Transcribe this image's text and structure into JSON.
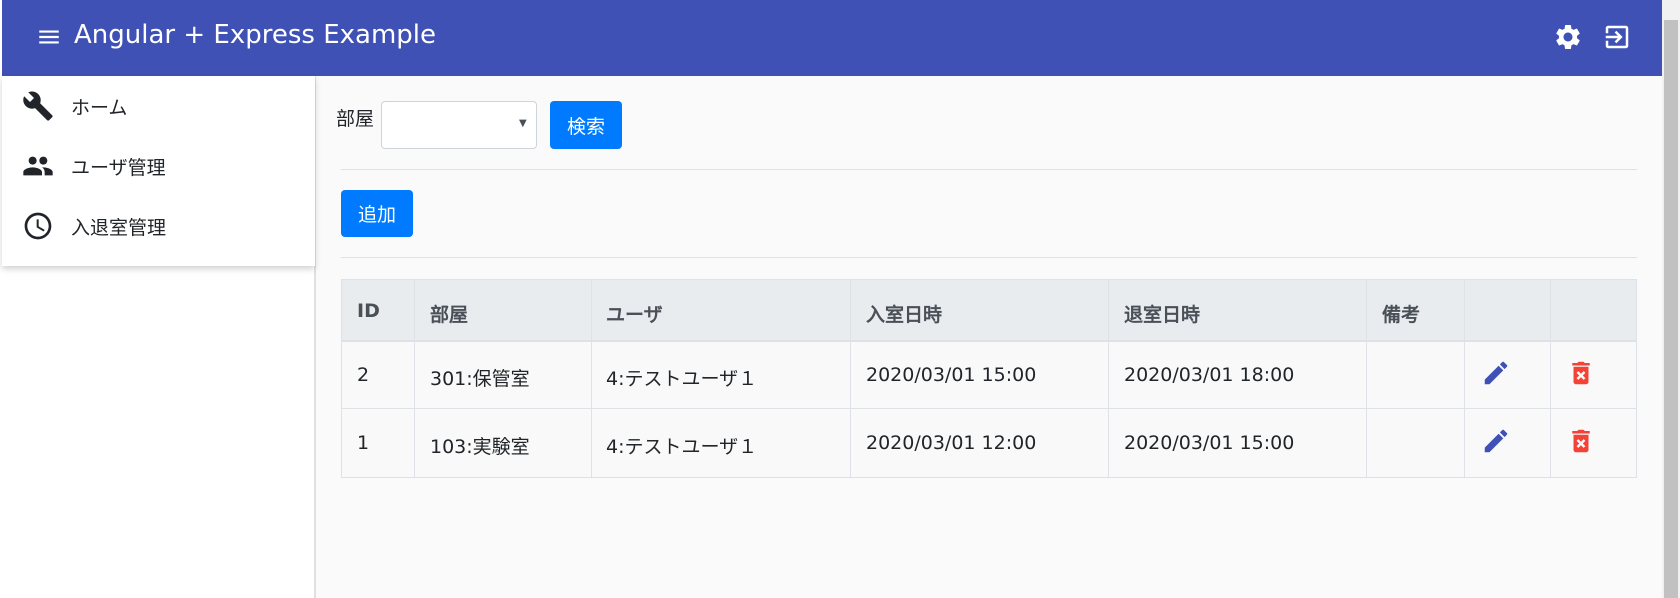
{
  "app": {
    "title": "Angular + Express Example",
    "accent_color": "#3f51b5",
    "primary_button_color": "#007bff",
    "icons": {
      "menu": "hamburger-menu-icon",
      "settings": "gear-icon",
      "logout": "exit-to-app-icon"
    }
  },
  "sidebar": {
    "items": [
      {
        "label": "ホーム",
        "icon": "wrench-icon"
      },
      {
        "label": "ユーザ管理",
        "icon": "people-icon"
      },
      {
        "label": "入退室管理",
        "icon": "clock-icon"
      }
    ]
  },
  "search": {
    "room_label": "部屋",
    "room_value": "",
    "search_button": "検索"
  },
  "actions": {
    "add_button": "追加"
  },
  "table": {
    "columns": [
      "ID",
      "部屋",
      "ユーザ",
      "入室日時",
      "退室日時",
      "備考",
      "",
      ""
    ],
    "rows": [
      {
        "id": "2",
        "room": "301:保管室",
        "user": "4:テストユーザ１",
        "entry": "2020/03/01 15:00",
        "exit": "2020/03/01 18:00",
        "note": "",
        "edit_icon": "pencil-icon",
        "delete_icon": "delete-icon"
      },
      {
        "id": "1",
        "room": "103:実験室",
        "user": "4:テストユーザ１",
        "entry": "2020/03/01 12:00",
        "exit": "2020/03/01 15:00",
        "note": "",
        "edit_icon": "pencil-icon",
        "delete_icon": "delete-icon"
      }
    ],
    "edit_icon_color": "#3f51b5",
    "delete_icon_color": "#f44336"
  }
}
